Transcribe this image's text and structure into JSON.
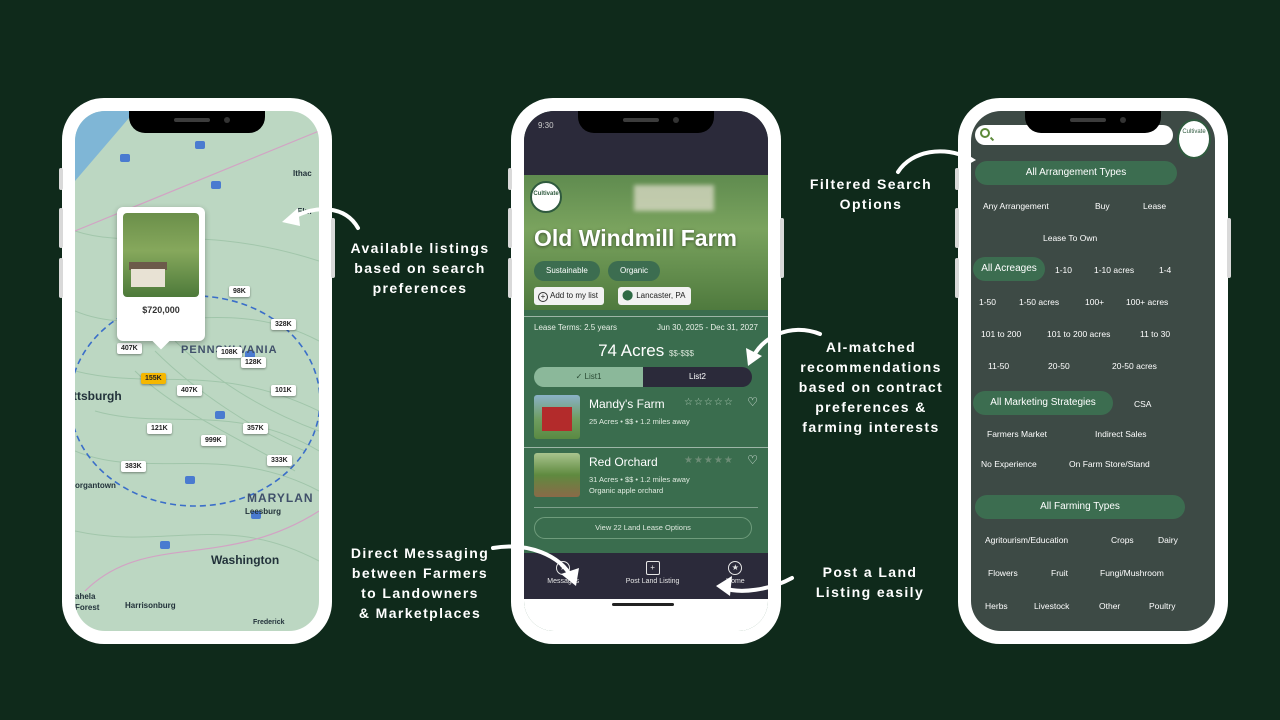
{
  "captions": {
    "listings": [
      "Available listings",
      "based on search",
      "preferences"
    ],
    "messaging": [
      "Direct Messaging",
      "between Farmers",
      "to Landowners",
      "& Marketplaces"
    ],
    "ai": [
      "AI-matched",
      "recommendations",
      "based on contract",
      "preferences &",
      "farming interests"
    ],
    "post": [
      "Post a Land",
      "Listing easily"
    ],
    "filtered": [
      "Filtered Search",
      "Options"
    ]
  },
  "map": {
    "labels": {
      "pennsylvania": "PENNSYLVANIA",
      "pittsburgh": "ttsburgh",
      "maryland": "MARYLAN",
      "washington": "Washington",
      "leesburg": "Leesburg",
      "harrisonburg": "Harrisonburg",
      "morgantown": "organtown",
      "ithaca": "Ithac",
      "elmira": "Elm",
      "forest": "ahela\nForest",
      "frederick": "Frederick"
    },
    "featured": {
      "price": "$720,000"
    },
    "price_tags": [
      {
        "label": "98K"
      },
      {
        "label": "328K"
      },
      {
        "label": "407K"
      },
      {
        "label": "108K"
      },
      {
        "label": "128K"
      },
      {
        "label": "155K",
        "selected": true
      },
      {
        "label": "407K"
      },
      {
        "label": "101K"
      },
      {
        "label": "121K"
      },
      {
        "label": "999K"
      },
      {
        "label": "357K"
      },
      {
        "label": "333K"
      },
      {
        "label": "383K"
      }
    ]
  },
  "detail": {
    "status_time": "9:30",
    "logo_text": "Cultivate",
    "title": "Old Windmill Farm",
    "tags": [
      "Sustainable",
      "Organic"
    ],
    "add_button": "Add to my list",
    "location": "Lancaster, PA",
    "lease_terms": "Lease Terms: 2.5 years",
    "lease_dates": "Jun 30, 2025 - Dec 31, 2027",
    "acres": "74 Acres",
    "price_range": "$$-$$$",
    "lists": [
      "List1",
      "List2"
    ],
    "farms": [
      {
        "name": "Mandy's Farm",
        "meta": "25 Acres • $$ • 1.2 miles away",
        "sub": "",
        "stars": "☆☆☆☆☆"
      },
      {
        "name": "Red Orchard",
        "meta": "31 Acres • $$ • 1.2 miles away",
        "sub": "Organic apple orchard",
        "stars": "★★★★★"
      }
    ],
    "view_button": "View 22 Land Lease Options",
    "tabs": [
      "Messages",
      "Post Land Listing",
      "Home"
    ]
  },
  "filters": {
    "logo_text": "Cultivate",
    "arrangement_header": "All Arrangement Types",
    "arrangements": [
      "Any Arrangement",
      "Buy",
      "Lease",
      "Lease To Own"
    ],
    "acreage_header": "All Acreages",
    "acreages": [
      "1-10",
      "1-10 acres",
      "1-4",
      "1-50",
      "1-50 acres",
      "100+",
      "100+ acres",
      "101 to 200",
      "101 to 200 acres",
      "11 to 30",
      "11-50",
      "20-50",
      "20-50 acres"
    ],
    "marketing_header": "All Marketing Strategies",
    "marketing": [
      "CSA",
      "Farmers Market",
      "Indirect Sales",
      "No Experience",
      "On Farm Store/Stand"
    ],
    "farming_header": "All Farming Types",
    "farming": [
      "Agritourism/Education",
      "Crops",
      "Dairy",
      "Flowers",
      "Fruit",
      "Fungi/Mushroom",
      "Herbs",
      "Livestock",
      "Other",
      "Poultry"
    ]
  },
  "colors": {
    "background": "#0f2a1b",
    "accent_green": "#3c6d50",
    "dark_bar": "#2b2a3a",
    "selected_tag": "#f5b700"
  }
}
